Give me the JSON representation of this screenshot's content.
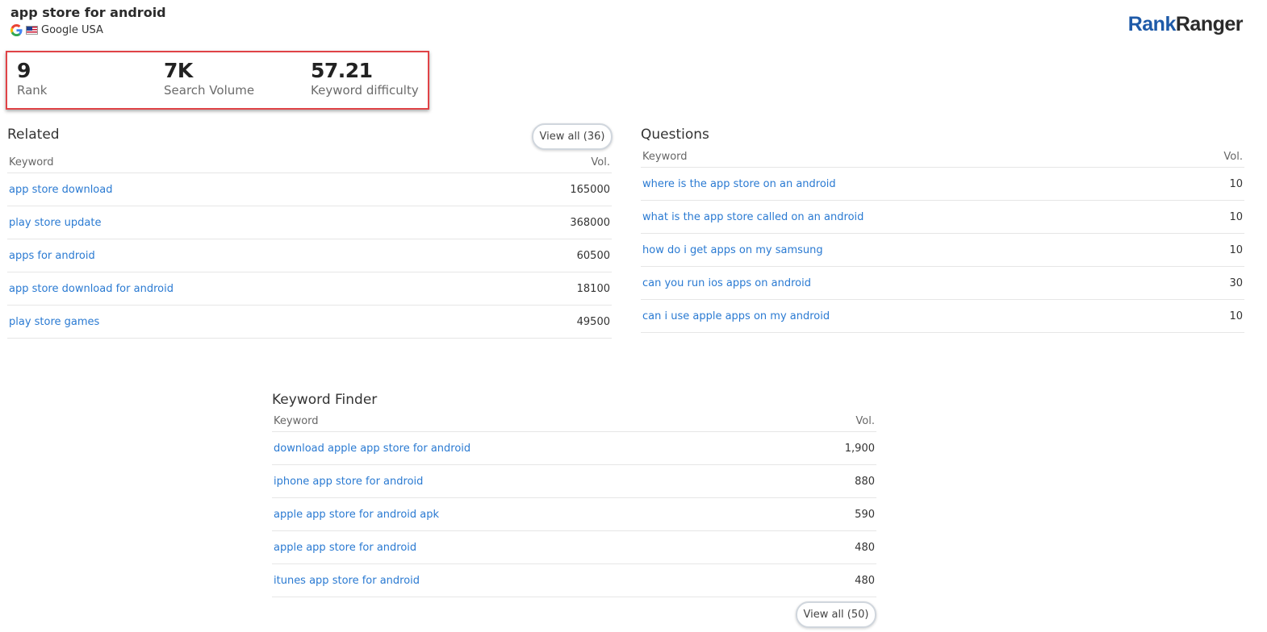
{
  "header": {
    "keyword": "app store for android",
    "engine_label": "Google USA",
    "engine_icon": "google-icon",
    "flag_icon": "us-flag-icon",
    "logo": {
      "part1": "Rank",
      "part2": "Ranger",
      "color1": "#1e5aa8",
      "color2": "#2b2b2b"
    }
  },
  "metrics": [
    {
      "value": "9",
      "label": "Rank"
    },
    {
      "value": "7K",
      "label": "Search Volume"
    },
    {
      "value": "57.21",
      "label": "Keyword difficulty"
    }
  ],
  "highlight_color": "#e04347",
  "related": {
    "title": "Related",
    "view_all": "View all (36)",
    "col_keyword": "Keyword",
    "col_vol": "Vol.",
    "rows": [
      {
        "keyword": "app store download",
        "vol": "165000"
      },
      {
        "keyword": "play store update",
        "vol": "368000"
      },
      {
        "keyword": "apps for android",
        "vol": "60500"
      },
      {
        "keyword": "app store download for android",
        "vol": "18100"
      },
      {
        "keyword": "play store games",
        "vol": "49500"
      }
    ]
  },
  "questions": {
    "title": "Questions",
    "col_keyword": "Keyword",
    "col_vol": "Vol.",
    "rows": [
      {
        "keyword": "where is the app store on an android",
        "vol": "10"
      },
      {
        "keyword": "what is the app store called on an android",
        "vol": "10"
      },
      {
        "keyword": "how do i get apps on my samsung",
        "vol": "10"
      },
      {
        "keyword": "can you run ios apps on android",
        "vol": "30"
      },
      {
        "keyword": "can i use apple apps on my android",
        "vol": "10"
      }
    ]
  },
  "finder": {
    "title": "Keyword Finder",
    "view_all": "View all (50)",
    "col_keyword": "Keyword",
    "col_vol": "Vol.",
    "rows": [
      {
        "keyword": "download apple app store for android",
        "vol": "1,900"
      },
      {
        "keyword": "iphone app store for android",
        "vol": "880"
      },
      {
        "keyword": "apple app store for android apk",
        "vol": "590"
      },
      {
        "keyword": "apple app store for android",
        "vol": "480"
      },
      {
        "keyword": "itunes app store for android",
        "vol": "480"
      }
    ]
  },
  "link_color": "#2a7ad2"
}
